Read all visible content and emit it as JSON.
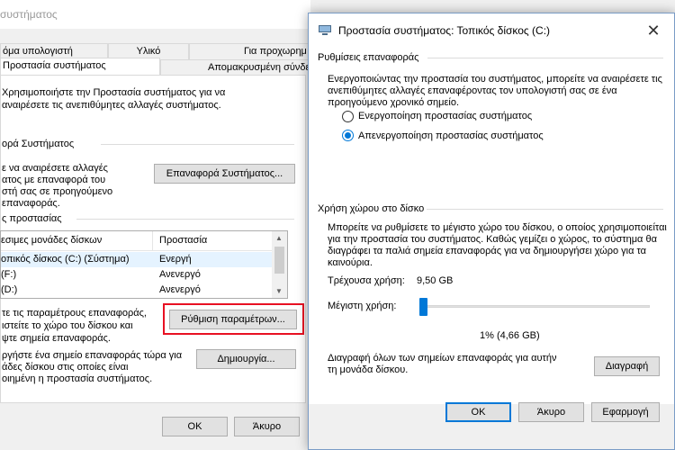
{
  "background_window": {
    "title": "συστήματος",
    "tabs_row1": [
      "όμα υπολογιστή",
      "Υλικό",
      "Για προχωρημ"
    ],
    "tabs_row2": [
      "Προστασία συστήματος",
      "Απομακρυσμένη σύνδε"
    ],
    "intro_line1": "Χρησιμοποιήστε την Προστασία συστήματος για να",
    "intro_line2": "αναιρέσετε τις ανεπιθύμητες αλλαγές συστήματος.",
    "restore_group_label": "ορά Συστήματος",
    "restore_desc": [
      "ε να αναιρέσετε αλλαγές",
      "ατος με επαναφορά του",
      "στή σας σε προηγούμενο",
      "επαναφοράς."
    ],
    "restore_button": "Επαναφορά Συστήματος...",
    "protection_group_label": "ς προστασίας",
    "list": {
      "col1": "εσιμες μονάδες δίσκων",
      "col2": "Προστασία",
      "rows": [
        {
          "drive": "οπικός δίσκος (C:) (Σύστημα)",
          "status": "Ενεργή"
        },
        {
          "drive": "(F:)",
          "status": "Ανενεργό"
        },
        {
          "drive": "(D:)",
          "status": "Ανενεργό"
        }
      ]
    },
    "configure_desc": [
      "τε τις παραμέτρους επαναφοράς,",
      "ιστείτε το χώρο του δίσκου και",
      "ψτε σημεία επαναφοράς."
    ],
    "configure_button": "Ρύθμιση παραμέτρων...",
    "create_desc": [
      "ργήστε ένα σημείο επαναφοράς τώρα για",
      "άδες δίσκου στις οποίες είναι",
      "οιημένη η προστασία συστήματος."
    ],
    "create_button": "Δημιουργία...",
    "ok_button": "OK",
    "cancel_button": "Άκυρο"
  },
  "dialog": {
    "title": "Προστασία συστήματος: Τοπικός δίσκος (C:)",
    "close_glyph": "✕",
    "restore_settings_label": "Ρυθμίσεις επαναφοράς",
    "restore_desc": [
      "Ενεργοποιώντας την προστασία του συστήματος, μπορείτε να αναιρέσετε τις",
      "ανεπιθύμητες αλλαγές επαναφέροντας τον υπολογιστή σας σε ένα",
      "προηγούμενο χρονικό σημείο."
    ],
    "radio_on": "Ενεργοποίηση προστασίας συστήματος",
    "radio_off": "Απενεργοποίηση προστασίας συστήματος",
    "selected_option": "off",
    "disk_usage_label": "Χρήση χώρου στο δίσκο",
    "disk_desc": [
      "Μπορείτε να ρυθμίσετε το μέγιστο χώρο του δίσκου, ο οποίος χρησιμοποιείται",
      "για την προστασία του συστήματος. Καθώς γεμίζει ο χώρος, το σύστημα θα",
      "διαγράφει τα παλιά σημεία επαναφοράς για να δημιουργήσει χώρο για τα",
      "καινούρια."
    ],
    "current_usage_label": "Τρέχουσα χρήση:",
    "current_usage_value": "9,50 GB",
    "max_usage_label": "Μέγιστη χρήση:",
    "max_usage_percent": 1,
    "max_usage_value": "1% (4,66 GB)",
    "delete_desc": [
      "Διαγραφή όλων των σημείων επαναφοράς για αυτήν",
      "τη μονάδα δίσκου."
    ],
    "delete_button": "Διαγραφή",
    "ok_button": "OK",
    "cancel_button": "Άκυρο",
    "apply_button": "Εφαρμογή"
  },
  "colors": {
    "accent": "#0078d7",
    "highlight_border": "#e81123"
  }
}
